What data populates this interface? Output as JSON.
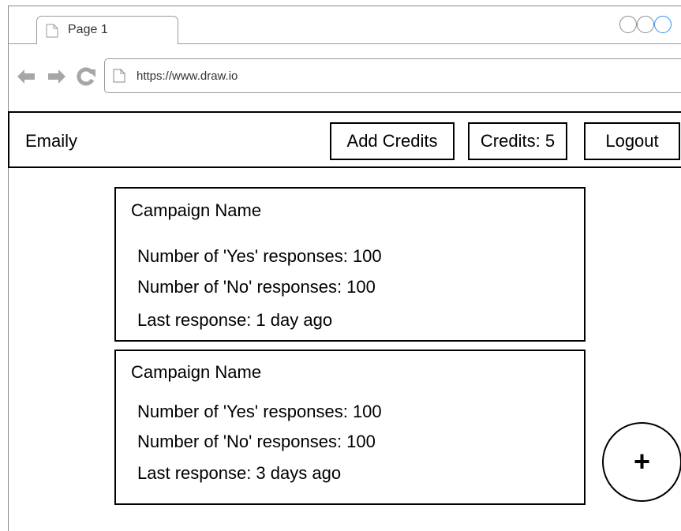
{
  "browser": {
    "tab_title": "Page 1",
    "url": "https://www.draw.io",
    "icons": {
      "back": "back-arrow-icon",
      "forward": "forward-arrow-icon",
      "reload": "reload-icon",
      "page": "page-icon"
    }
  },
  "navbar": {
    "brand": "Emaily",
    "add_credits_label": "Add Credits",
    "credits_label": "Credits: 5",
    "logout_label": "Logout"
  },
  "campaigns": [
    {
      "name": "Campaign Name",
      "yes_line": "Number of 'Yes' responses: 100",
      "no_line": "Number of 'No' responses: 100",
      "last_line": "Last response: 1 day ago"
    },
    {
      "name": "Campaign Name",
      "yes_line": "Number of 'Yes' responses: 100",
      "no_line": "Number of 'No' responses: 100",
      "last_line": "Last response: 3 days ago"
    }
  ],
  "fab": {
    "label": "+"
  },
  "colors": {
    "border": "#000000",
    "chrome_border": "#9a9a9a",
    "nav_icon": "#a6a6a6",
    "window_control_accent": "#2f8ff0"
  }
}
